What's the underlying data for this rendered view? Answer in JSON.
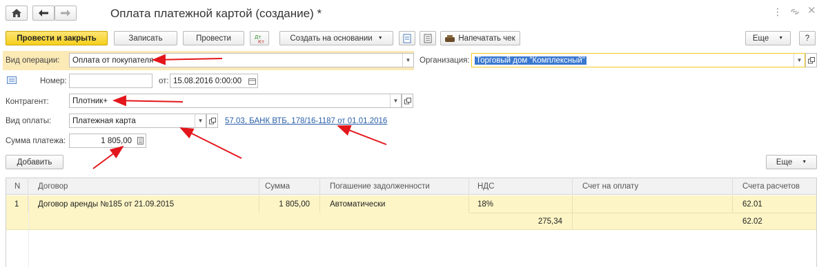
{
  "window": {
    "title": "Оплата платежной картой (создание) *",
    "home_icon": "home-icon",
    "back_icon": "arrow-left-icon",
    "forward_icon": "arrow-right-icon",
    "menu_icon": "more-vert-icon",
    "link_icon": "link-icon",
    "close_icon": "close-icon"
  },
  "toolbar": {
    "post_close": "Провести и закрыть",
    "save": "Записать",
    "post": "Провести",
    "create_based": "Создать на основании",
    "print_check": "Напечатать чек",
    "more": "Еще",
    "help": "?"
  },
  "form": {
    "op_type_label": "Вид операции:",
    "op_type_value": "Оплата от покупателя",
    "org_label": "Организация:",
    "org_value": "Торговый дом \"Комплексный\"",
    "number_label": "Номер:",
    "number_value": "",
    "from_label": "от:",
    "date_value": "15.08.2016  0:00:00",
    "counterparty_label": "Контрагент:",
    "counterparty_value": "Плотник+",
    "payment_kind_label": "Вид оплаты:",
    "payment_kind_value": "Платежная карта",
    "account_link": "57.03, БАНК ВТБ, 178/16-1187 от 01.01.2016",
    "amount_label": "Сумма платежа:",
    "amount_value": "1 805,00"
  },
  "table_toolbar": {
    "add": "Добавить",
    "more": "Еще"
  },
  "table": {
    "columns": [
      "N",
      "Договор",
      "Сумма",
      "Погашение задолженности",
      "НДС",
      "Счет на оплату",
      "Счета расчетов"
    ],
    "row": {
      "n": "1",
      "contract": "Договор аренды №185 от 21.09.2015",
      "amount": "1 805,00",
      "repayment": "Автоматически",
      "vat_rate": "18%",
      "vat_amount": "275,34",
      "invoice": "",
      "account1": "62.01",
      "account2": "62.02"
    }
  },
  "colors": {
    "accent_yellow": "#f5cf1d",
    "row_highlight": "#fdf5c6",
    "link_blue": "#2a5fa8",
    "annotation_red": "#e3161b",
    "selection_blue": "#3a78d0"
  }
}
